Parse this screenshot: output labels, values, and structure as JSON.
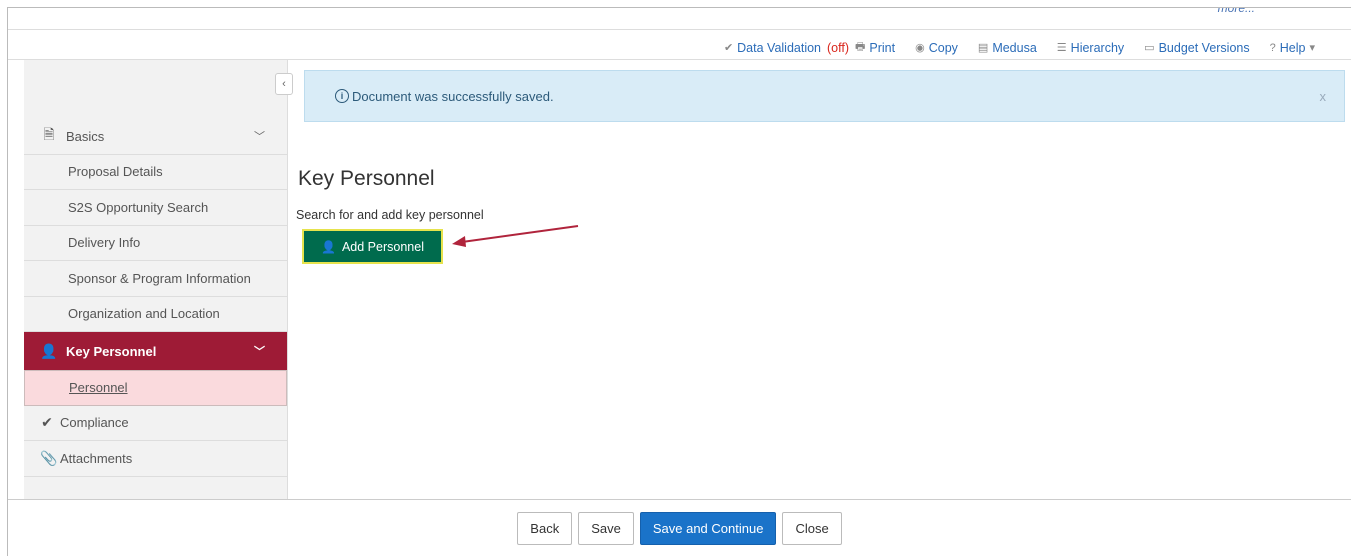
{
  "top": {
    "more_label": "more..."
  },
  "toolbar": {
    "data_validation": "Data Validation",
    "data_validation_state": "(off)",
    "print": "Print",
    "copy": "Copy",
    "medusa": "Medusa",
    "hierarchy": "Hierarchy",
    "budget_versions": "Budget Versions",
    "help": "Help"
  },
  "sidebar": {
    "collapse_glyph": "‹",
    "items": [
      {
        "label": "Basics"
      },
      {
        "label": "Proposal Details"
      },
      {
        "label": "S2S Opportunity Search"
      },
      {
        "label": "Delivery Info"
      },
      {
        "label": "Sponsor & Program Information"
      },
      {
        "label": "Organization and Location"
      },
      {
        "label": "Key Personnel"
      },
      {
        "label": "Personnel"
      },
      {
        "label": "Compliance"
      },
      {
        "label": "Attachments"
      }
    ]
  },
  "alert": {
    "message": "Document was successfully saved.",
    "close": "x"
  },
  "main": {
    "title": "Key Personnel",
    "instructions": "Search for and add key personnel",
    "add_button": "Add Personnel"
  },
  "footer": {
    "back": "Back",
    "save": "Save",
    "save_continue": "Save and Continue",
    "close": "Close"
  },
  "colors": {
    "active_nav": "#9e1b36",
    "selected_nav": "#fadadd",
    "add_button_bg": "#006b4d",
    "primary_button": "#1a73c9",
    "alert_bg": "#d9ecf7",
    "link": "#2b6cb8",
    "arrow": "#b0243c"
  }
}
